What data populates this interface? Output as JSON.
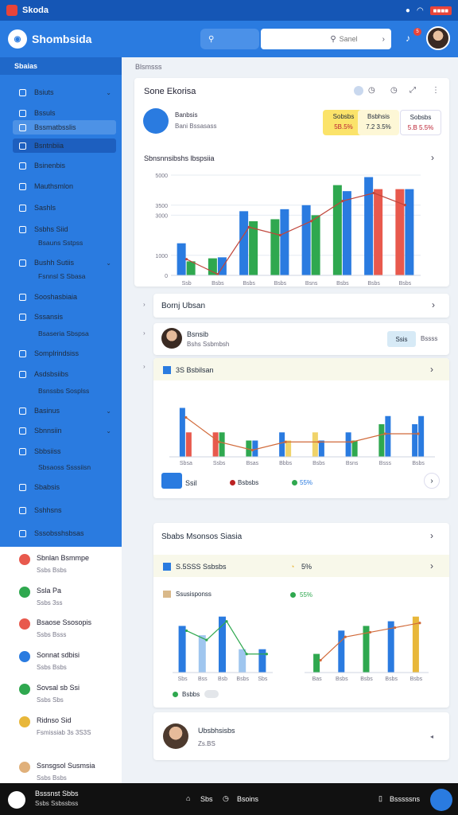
{
  "status": {
    "app_title": "Skoda",
    "battery": "■■■■"
  },
  "header": {
    "brand": "Shombsida",
    "search_placeholder": "Sanel",
    "badge": "5"
  },
  "sidebar": {
    "heading": "Sbaias",
    "items": [
      {
        "label": "Bsiuts",
        "icon": "home-icon"
      },
      {
        "label": "Bssuls",
        "icon": "link-icon"
      },
      {
        "label": "Bssmatbsslis",
        "icon": "doc-icon"
      },
      {
        "label": "Bsntnbiia",
        "icon": "doc-icon"
      },
      {
        "label": "Bsinenbis",
        "icon": "grid-icon"
      },
      {
        "label": "Mauthsmlon",
        "icon": "grid-icon"
      },
      {
        "label": "Sashls",
        "icon": "tag-icon"
      },
      {
        "label": "Ssbhs Siid",
        "icon": "image-icon"
      },
      {
        "label": "Bushh Sutiis",
        "icon": "alert-icon"
      },
      {
        "label": "Sooshasbiaia",
        "icon": "mail-icon"
      },
      {
        "label": "Sssansis",
        "icon": "link-icon"
      },
      {
        "label": "Somplrindsiss",
        "icon": "doc-icon"
      },
      {
        "label": "Asdsbsiibs",
        "icon": "tag-icon"
      },
      {
        "label": "Basinus",
        "icon": "grid-icon"
      },
      {
        "label": "Sbnnsiin",
        "icon": "card-icon"
      },
      {
        "label": "Sbbsiiss",
        "icon": "edit-icon"
      },
      {
        "label": "Sbabsis",
        "icon": "grid-icon"
      },
      {
        "label": "Sshhsns",
        "icon": "grid-icon"
      },
      {
        "label": "Sssobsshsbsas",
        "icon": "doc-icon"
      }
    ],
    "subs": [
      "Bsauns Sstpss",
      "Fsnnsl S Sbasa",
      "Bsaseria Sbspsa",
      "Bsnssbs Sosplss",
      "Sbsaoss Ssssiisn"
    ],
    "lower": [
      {
        "title": "Sbnlan Bsmmpe",
        "sub": "Ssbs Bsbs",
        "color": "#e8594d"
      },
      {
        "title": "Ssla Pa",
        "sub": "Ssbs 3ss",
        "color": "#2fa84f"
      },
      {
        "title": "Bsaose Ssosopis",
        "sub": "Ssbs Bsss",
        "color": "#e8594d"
      },
      {
        "title": "Sonnat sdbisi",
        "sub": "Ssbs Bsbs",
        "color": "#2a7be0"
      },
      {
        "title": "Sovsal sb Ssi",
        "sub": "Ssbs Sbs",
        "color": "#2fa84f"
      },
      {
        "title": "Ridnso Sid",
        "sub": "Fsmissiab 3s 3S3S",
        "color": "#e8b73a"
      },
      {
        "title": "Ssnsgsol Susmsia",
        "sub": "Ssbs Bsbs",
        "color": "#e0b07a"
      }
    ]
  },
  "breadcrumb": "Blsmsss",
  "card1": {
    "title": "Sone Ekorisa",
    "summary_title": "Banbsis",
    "summary_sub": "Bani Bssasass",
    "kpis": [
      {
        "label": "Sobsbs",
        "value": "5B.5%"
      },
      {
        "label": "Bsbhsis",
        "value": "7.2 3.5%"
      },
      {
        "label": "Sobsbs",
        "value": "5.B 5.5%"
      }
    ],
    "chart_title": "Sbnsnnsibshs lbspsiia"
  },
  "card2": {
    "title": "Bornj Ubsan"
  },
  "card3": {
    "name": "Bsnsib",
    "sub": "Bshs Ssbmbsh",
    "button": "Ssis",
    "extra": "Bssss"
  },
  "card4": {
    "title": "3S Bsbilsan",
    "stat1": "Ssil",
    "stat2": "Bsbsbs",
    "stat3": "55%"
  },
  "card5": {
    "title": "Sbabs Msonsos Siasia",
    "sub_title": "S.5SSS Ssbsbs",
    "sub_value": "5%",
    "legend_title": "Ssusisponss",
    "legend_pct": "55%",
    "legend_name": "Bsbbs"
  },
  "card6": {
    "name": "Ubsbhsisbs",
    "sub": "Zs.BS"
  },
  "bottom": {
    "caption": "Bsssnst Sbbs",
    "caption_sub": "Ssbs Ssbssbss",
    "item1": "Sbs",
    "item2": "Bsoins",
    "item3": "Bsssssns"
  },
  "colors": {
    "primary": "#2a7be0",
    "sidebar": "#2a7be0",
    "green": "#2fa84f",
    "red": "#e8594d"
  },
  "chart_data": [
    {
      "type": "bar",
      "title": "Sbnsnnsibshs lbspsiia",
      "categories": [
        "Ssb",
        "Bsbs",
        "Bsbs",
        "Bsbs",
        "Bsns",
        "Bsbs",
        "Bsbs",
        "Bsbs"
      ],
      "series": [
        {
          "values": [
            1600,
            850,
            3200,
            2800,
            3500,
            4500,
            4900,
            4300
          ]
        },
        {
          "values": [
            700,
            900,
            2700,
            3300,
            3000,
            4200,
            4300,
            4300
          ]
        }
      ],
      "ylim": [
        0,
        5000
      ],
      "yticks": [
        0,
        1000,
        3000,
        3500,
        5000
      ]
    },
    {
      "type": "bar",
      "categories": [
        "Sbsa",
        "Ssbs",
        "Bsas",
        "Bbbs",
        "Bsbs",
        "Bsns",
        "Bsss",
        "Bsbs"
      ],
      "series": [
        {
          "values": [
            6,
            3,
            2,
            3,
            3,
            3,
            4,
            4
          ]
        },
        {
          "values": [
            3,
            3,
            2,
            2,
            2,
            2,
            5,
            5
          ]
        }
      ],
      "ylim": [
        0,
        8
      ]
    },
    {
      "type": "bar",
      "categories": [
        "Sbs",
        "Bss",
        "Bsb",
        "Bsbs",
        "Sbs"
      ],
      "series": [
        {
          "values": [
            50,
            40,
            60,
            25,
            25
          ]
        }
      ],
      "ylim": [
        0,
        70
      ]
    },
    {
      "type": "bar",
      "categories": [
        "Bas",
        "Bsbs",
        "Bsbs",
        "Bsbs",
        "Bsbs"
      ],
      "series": [
        {
          "values": [
            20,
            45,
            50,
            55,
            60
          ]
        }
      ],
      "ylim": [
        0,
        70
      ]
    }
  ]
}
